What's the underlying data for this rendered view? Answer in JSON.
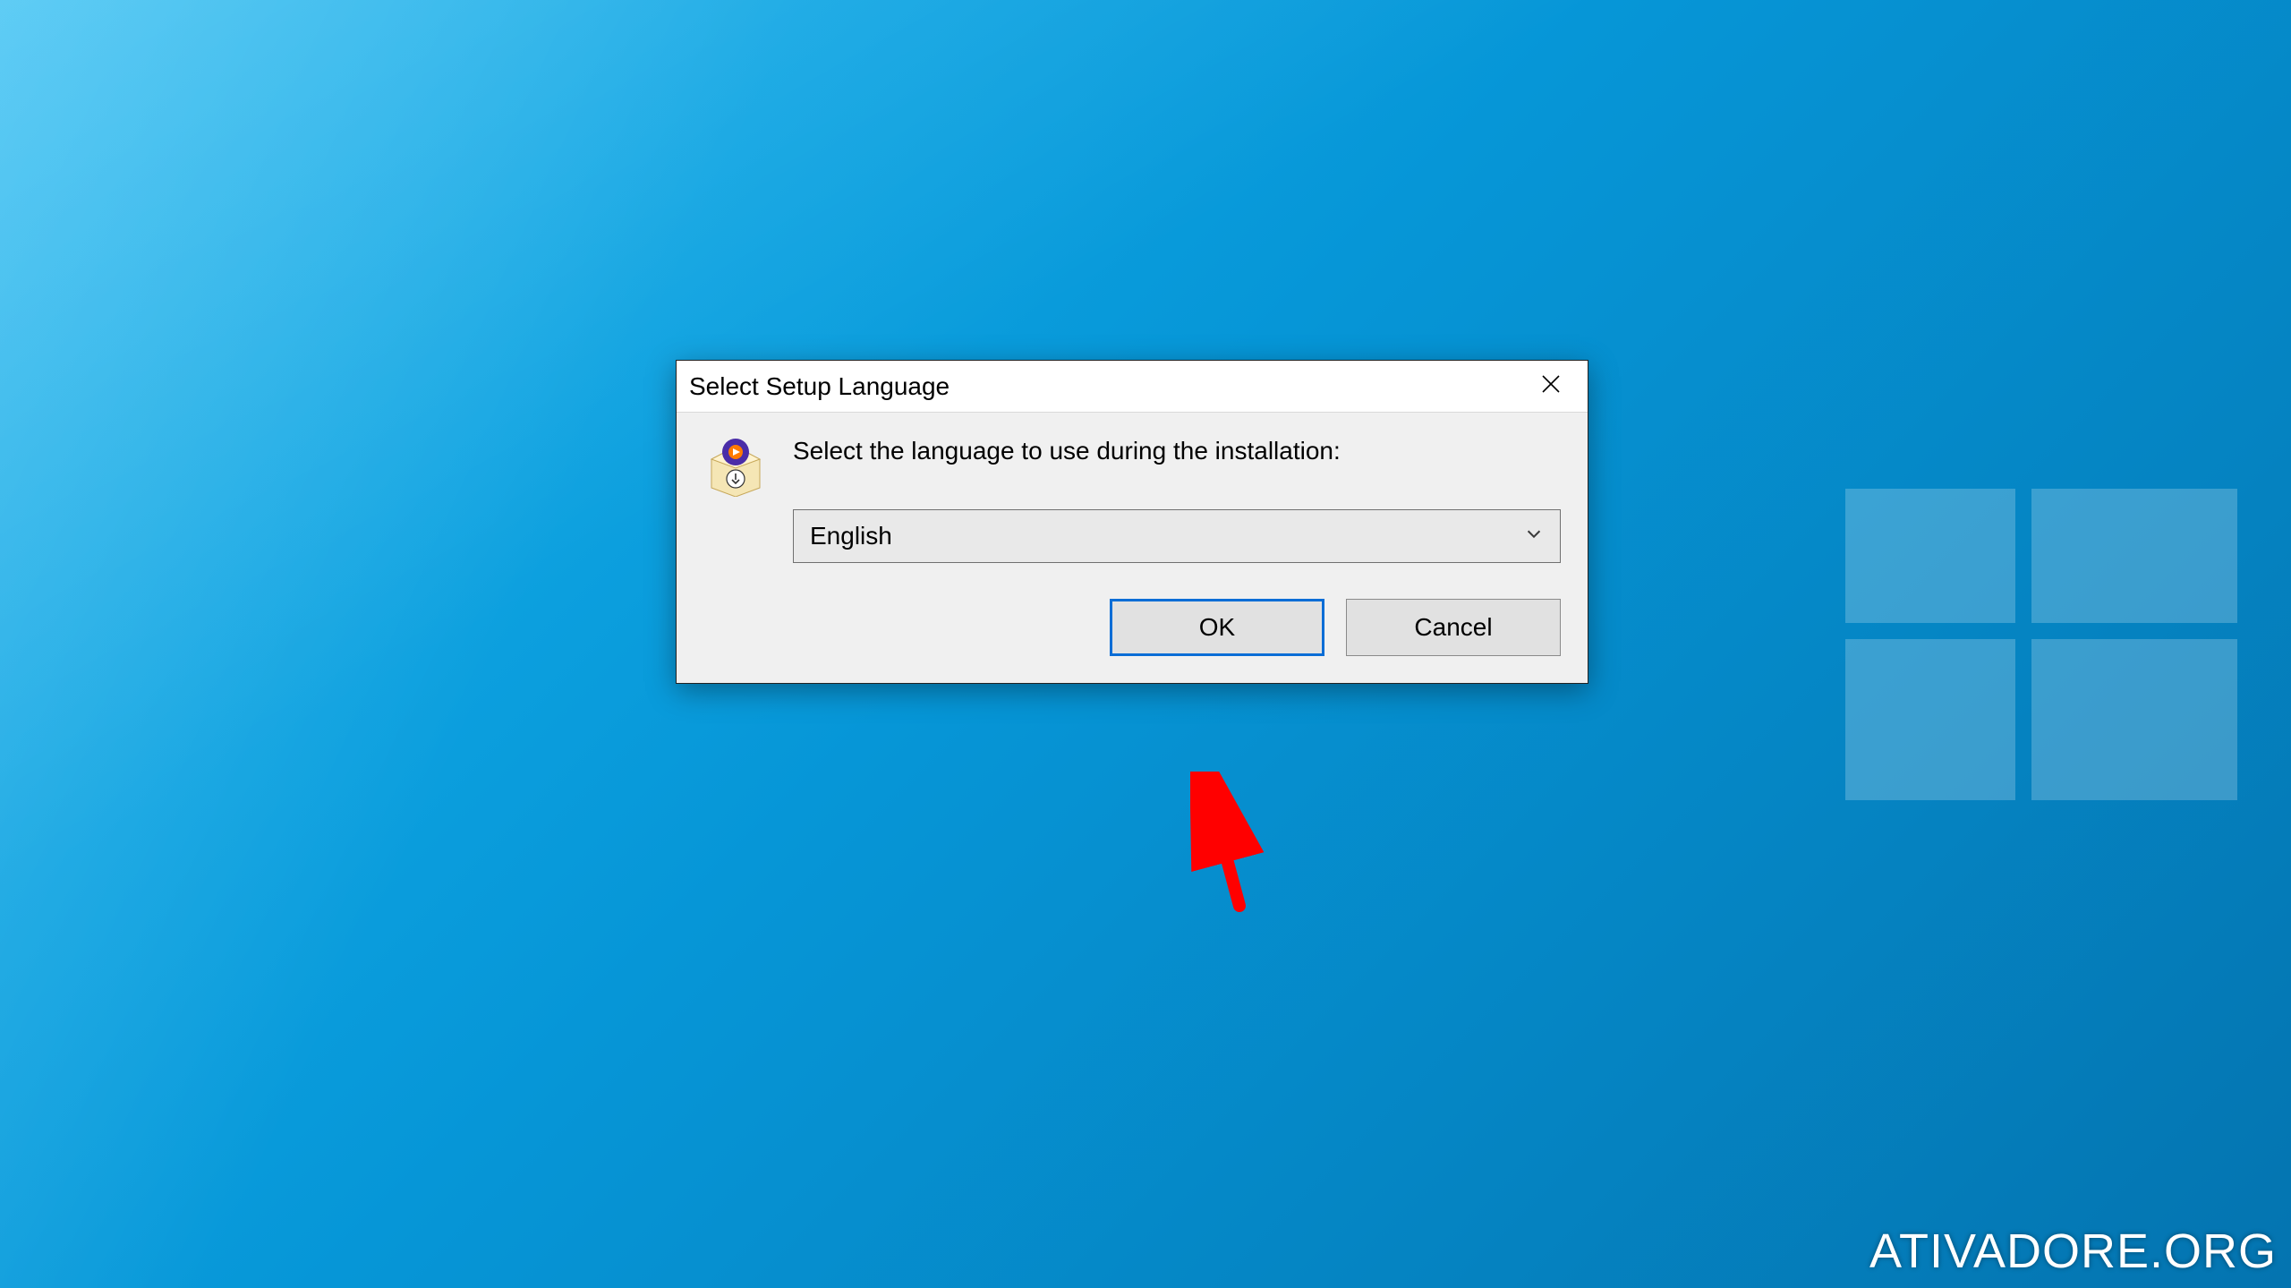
{
  "dialog": {
    "title": "Select Setup Language",
    "instruction": "Select the language to use during the installation:",
    "language_value": "English",
    "ok_label": "OK",
    "cancel_label": "Cancel"
  },
  "watermark": "ATIVADORE.ORG"
}
